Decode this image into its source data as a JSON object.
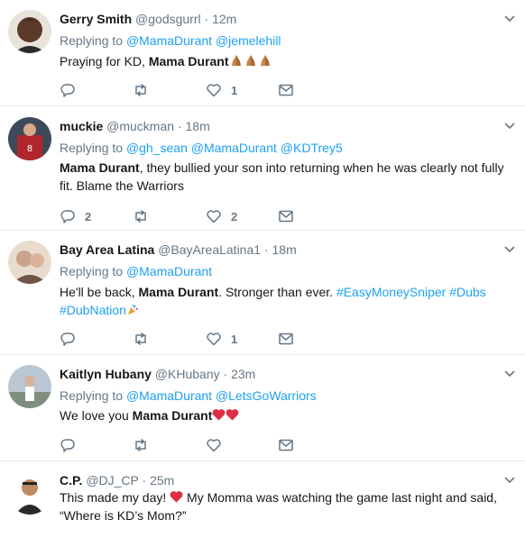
{
  "tweets": [
    {
      "name": "Gerry Smith",
      "handle": "@godsgurrl",
      "dot": "·",
      "time": "12m",
      "replying_prefix": "Replying to",
      "replying_to": [
        "@MamaDurant",
        "@jemelehill"
      ],
      "text_before": "Praying for KD, ",
      "text_bold": "Mama Durant",
      "emoji": [
        "folded-hands",
        "folded-hands",
        "folded-hands"
      ],
      "reply_count": "",
      "retweet_count": "",
      "like_count": "1",
      "avatar_color": "#5b3a2a"
    },
    {
      "name": "muckie",
      "handle": "@muckman",
      "dot": "·",
      "time": "18m",
      "replying_prefix": "Replying to",
      "replying_to": [
        "@gh_sean",
        "@MamaDurant",
        "@KDTrey5"
      ],
      "text_bold": "Mama Durant",
      "text_after": ", they bullied your son into returning when he was clearly not fully fit. Blame the Warriors",
      "reply_count": "2",
      "retweet_count": "",
      "like_count": "2",
      "avatar_color": "#b0262c"
    },
    {
      "name": "Bay Area Latina",
      "handle": "@BayAreaLatina1",
      "dot": "·",
      "time": "18m",
      "replying_prefix": "Replying to",
      "replying_to": [
        "@MamaDurant"
      ],
      "text_before": "He'll be back, ",
      "text_bold": "Mama Durant",
      "text_after": ". Stronger than ever. ",
      "hashtags": [
        "#EasyMoneySniper",
        "#Dubs",
        "#DubNation"
      ],
      "reply_count": "",
      "retweet_count": "",
      "like_count": "1",
      "avatar_color": "#c9a38a"
    },
    {
      "name": "Kaitlyn Hubany",
      "handle": "@KHubany",
      "dot": "·",
      "time": "23m",
      "replying_prefix": "Replying to",
      "replying_to": [
        "@MamaDurant",
        "@LetsGoWarriors"
      ],
      "text_before": "We love you ",
      "text_bold": "Mama Durant",
      "emoji": [
        "red-heart",
        "red-heart"
      ],
      "reply_count": "",
      "retweet_count": "",
      "like_count": "",
      "avatar_color": "#8a9aa8"
    },
    {
      "name": "C.P.",
      "handle": "@DJ_CP",
      "dot": "·",
      "time": "25m",
      "text_line1_before": "This made my day! ",
      "text_line1_after": " My Momma was watching the game last night and said,",
      "text_line2": "“Where is KD’s Mom?”",
      "avatar_color": "#2a2a2a"
    }
  ],
  "colors": {
    "link": "#1da1f2",
    "secondary": "#657786",
    "divider": "#e6ecf0",
    "heart": "#e0245e"
  }
}
